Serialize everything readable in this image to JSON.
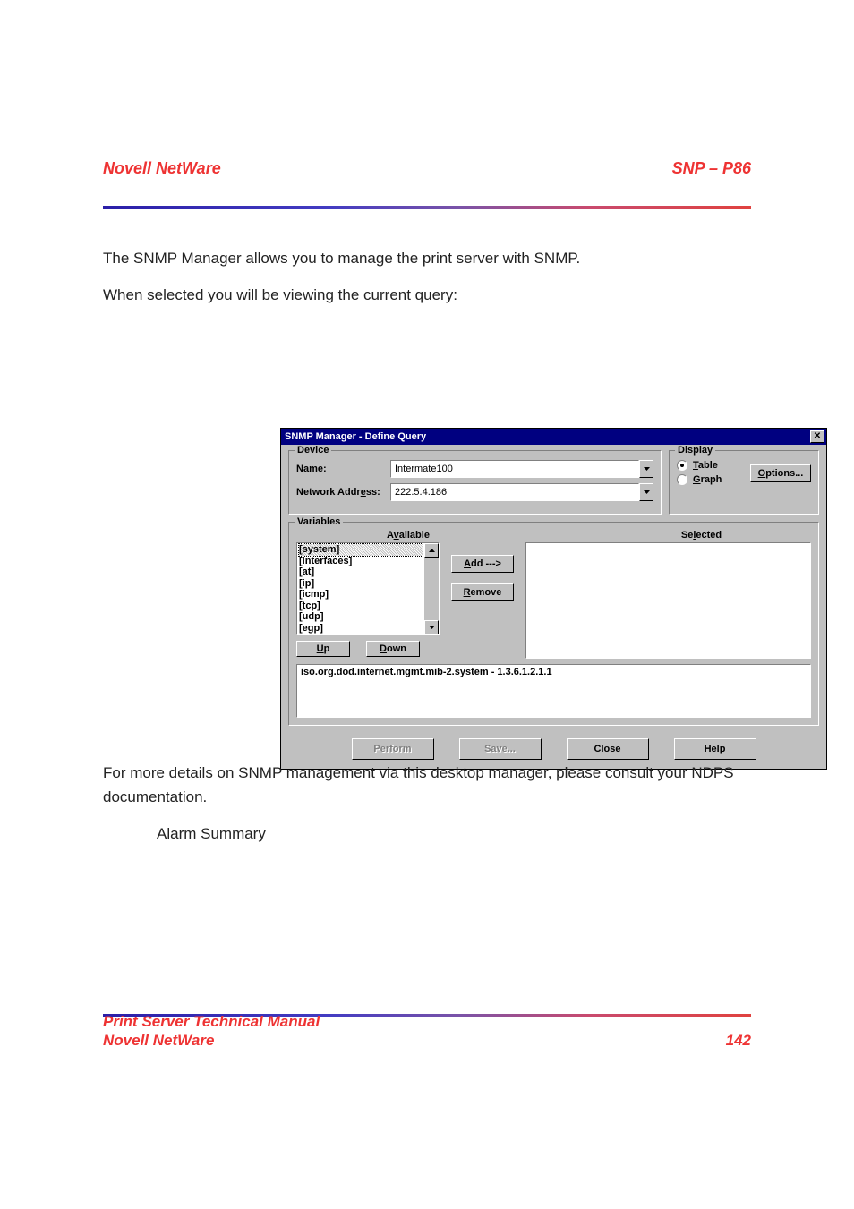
{
  "header": {
    "left": "Novell NetWare",
    "right": "SNP – P86"
  },
  "footer": {
    "left_line1": "Print Server Technical Manual",
    "left_line2": "Novell NetWare",
    "right": "142"
  },
  "body_top": {
    "p1": "The SNMP Manager allows you to manage the print server with SNMP.",
    "p2": "When selected you will be viewing the current query:"
  },
  "body_bottom": {
    "p1": "For more details on SNMP management via this desktop manager, please consult your NDPS documentation.",
    "p2": "Alarm Summary"
  },
  "dialog": {
    "title": "SNMP Manager - Define Query",
    "device": {
      "group_label": "Device",
      "name_label_pre": "N",
      "name_label_post": "ame:",
      "addr_label_pre": "Network Addr",
      "addr_label_ul": "e",
      "addr_label_post": "ss:",
      "name_value": "Intermate100",
      "addr_value": "222.5.4.186"
    },
    "display": {
      "group_label": "Display",
      "table_ul": "T",
      "table_rest": "able",
      "graph_ul": "G",
      "graph_rest": "raph",
      "options_ul": "O",
      "options_rest": "ptions..."
    },
    "variables": {
      "group_label": "Variables",
      "available_label_pre": "A",
      "available_label_ul": "v",
      "available_label_post": "ailable",
      "selected_label_pre": "Se",
      "selected_label_ul": "l",
      "selected_label_post": "ected",
      "items": [
        "[system]",
        "[interfaces]",
        "[at]",
        "[ip]",
        "[icmp]",
        "[tcp]",
        "[udp]",
        "[egp]"
      ],
      "selected_index": 0,
      "add_ul": "A",
      "add_rest": "dd --->",
      "remove_ul": "R",
      "remove_rest": "emove",
      "up_ul": "U",
      "up_rest": "p",
      "down_ul": "D",
      "down_rest": "own",
      "path": "iso.org.dod.internet.mgmt.mib-2.system  -  1.3.6.1.2.1.1"
    },
    "buttons": {
      "perform": "Perform",
      "save": "Save...",
      "close": "Close",
      "help_ul": "H",
      "help_rest": "elp"
    }
  }
}
